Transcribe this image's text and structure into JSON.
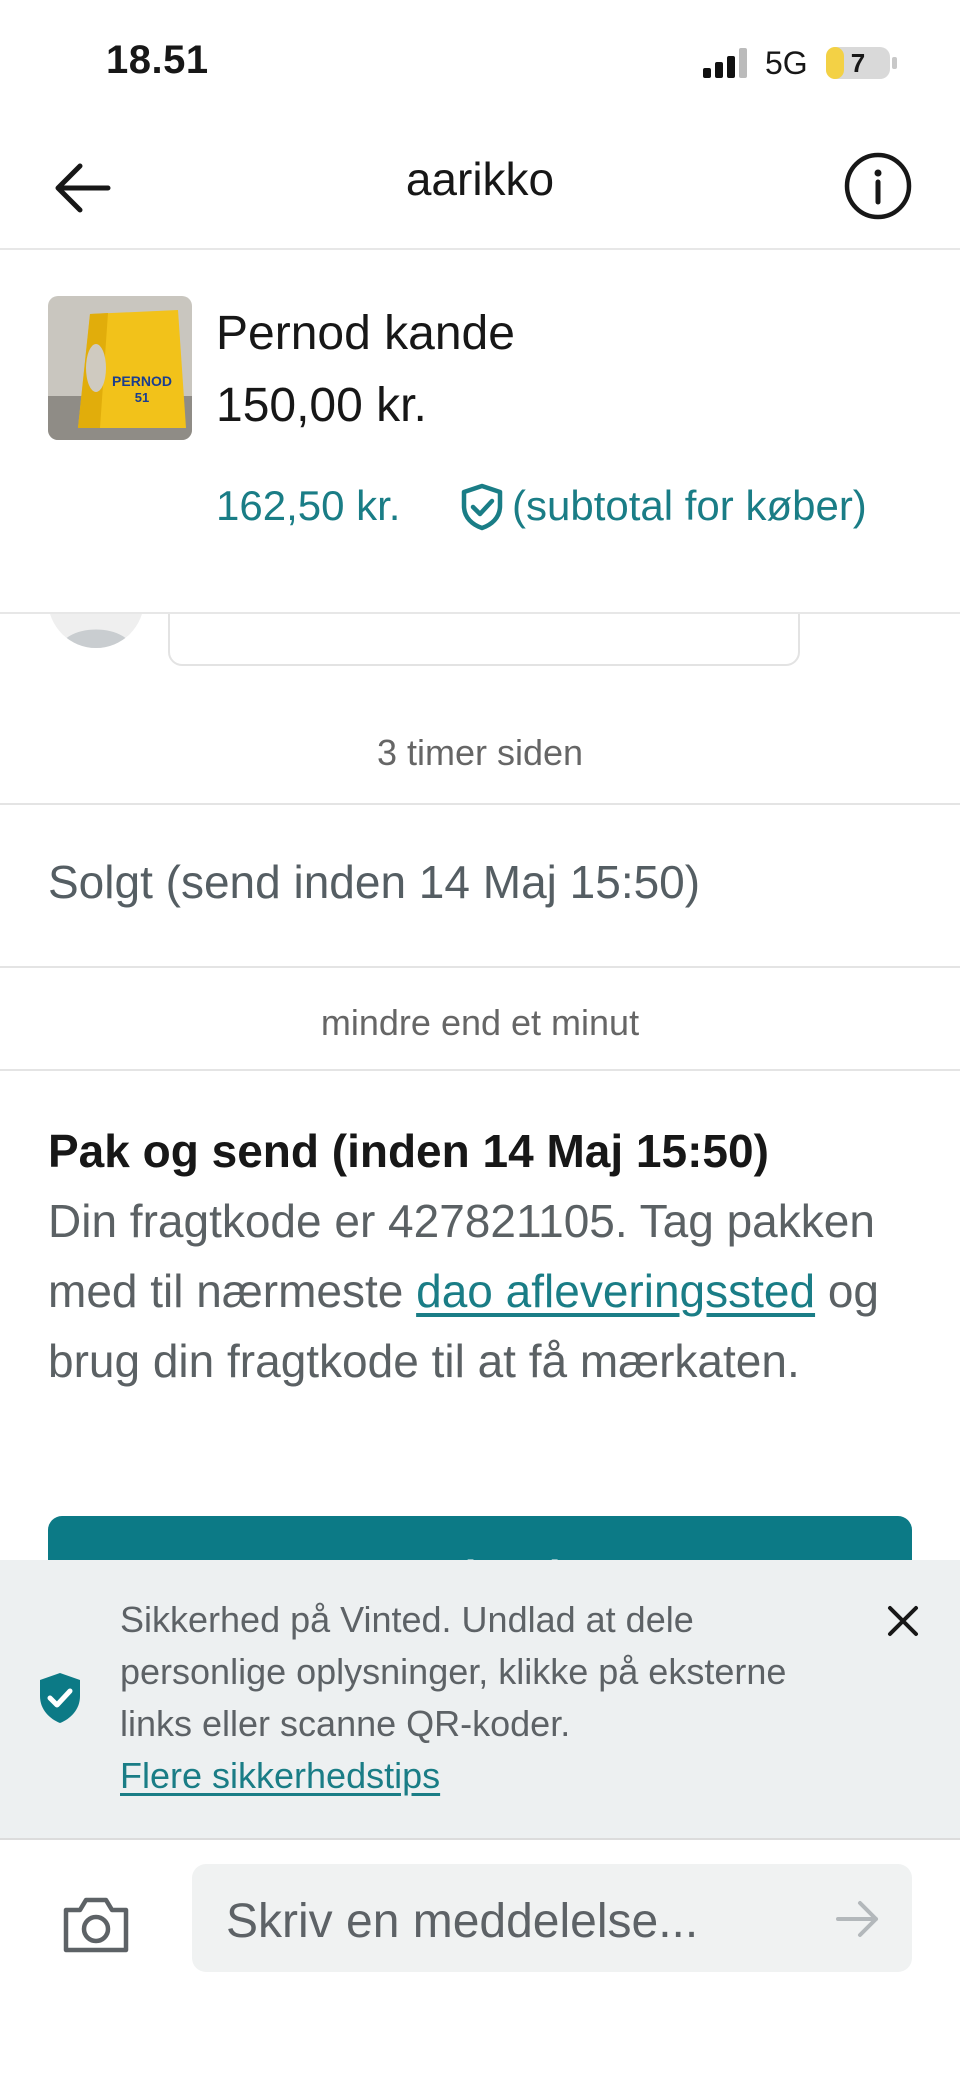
{
  "status_bar": {
    "time": "18.51",
    "network": "5G",
    "battery": "7",
    "battery_level": 0.07
  },
  "header": {
    "title": "aarikko"
  },
  "product": {
    "title": "Pernod kande",
    "price": "150,00 kr.",
    "buyer_price": "162,50 kr.",
    "buyer_note": "(subtotal for køber)",
    "thumb_text_line1": "PERNOD",
    "thumb_text_line2": "51"
  },
  "messages": {
    "time1": "3 timer siden",
    "status": "Solgt (send inden 14 Maj 15:50)",
    "time2": "mindre end et minut",
    "action_title": "Pak og send (inden 14 Maj 15:50)",
    "action_body_1": "Din fragtkode er 427821105. Tag pakken med til nærmeste ",
    "action_link": "dao afleveringssted",
    "action_body_2": " og brug din fragtkode til at få mærkaten.",
    "primary_button": "Fragtoplysninger"
  },
  "safety": {
    "text": "Sikkerhed på Vinted. Undlad at dele personlige oplysninger, klikke på eksterne links eller scanne QR-koder.",
    "link": "Flere sikkerhedstips"
  },
  "composer": {
    "placeholder": "Skriv en meddelelse..."
  },
  "colors": {
    "accent": "#0c7a86",
    "link": "#1a7d86",
    "banner_bg": "#edf0f1"
  },
  "icons": [
    "back-arrow-icon",
    "info-icon",
    "shield-check-icon",
    "close-icon",
    "camera-icon",
    "send-arrow-icon"
  ]
}
